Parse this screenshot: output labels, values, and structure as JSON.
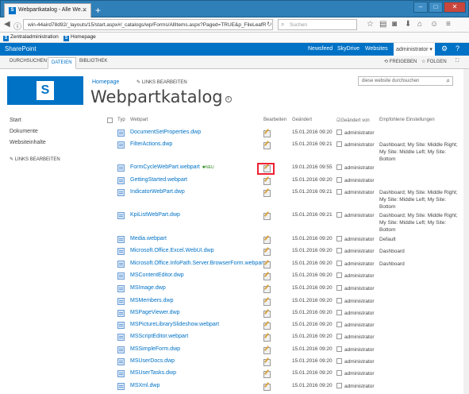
{
  "browser": {
    "tab_title": "Webpartkatalog - Alle We...",
    "new_tab": "+",
    "url": "win-44aird78d92/_layouts/15/start.aspx#/_catalogs/wp/Forms/AllItems.aspx?Paged=TRUE&p_FileLeafR",
    "search_placeholder": "Suchen",
    "bookmarks": [
      "Zentraladministration",
      "Homepage"
    ]
  },
  "suite": {
    "brand": "SharePoint",
    "links": [
      "Newsfeed",
      "SkyDrive",
      "Websites"
    ],
    "user": "administrator"
  },
  "ribbon": {
    "tabs": [
      "DURCHSUCHEN",
      "DATEIEN",
      "BIBLIOTHEK"
    ],
    "active_tab": "DATEIEN",
    "share": "FREIGEBEN",
    "follow": "FOLGEN"
  },
  "header": {
    "breadcrumb": "Homepage",
    "edit_links": "LINKS BEARBEITEN",
    "title": "Webpartkatalog",
    "site_search_placeholder": "diese website durchsuchen"
  },
  "quicklaunch": {
    "items": [
      "Start",
      "Dokumente",
      "Websiteinhalte"
    ],
    "edit_links": "LINKS BEARBEITEN"
  },
  "list": {
    "columns": {
      "type": "Typ",
      "name": "Webpart",
      "edit": "Bearbeiten",
      "modified": "Geändert",
      "modified_by": "Geändert von",
      "recommended": "Empfohlene Einstellungen"
    },
    "new_badge": "NEU",
    "rows": [
      {
        "name": "DocumentSetProperties.dwp",
        "modified": "15.01.2016 09:20",
        "by": "administrator",
        "rec": ""
      },
      {
        "name": "FilterActions.dwp",
        "modified": "15.01.2016 09:21",
        "by": "administrator",
        "rec": "Dashboard; My Site: Middle Right; My Site: Middle Left; My Site: Bottom"
      },
      {
        "name": "FormCycleWebPart.webpart",
        "modified": "19.01.2016 09:55",
        "by": "administrator",
        "rec": ""
      },
      {
        "name": "GettingStarted.webpart",
        "modified": "15.01.2016 09:20",
        "by": "administrator",
        "rec": ""
      },
      {
        "name": "IndicatorWebPart.dwp",
        "modified": "15.01.2016 09:21",
        "by": "administrator",
        "rec": "Dashboard; My Site: Middle Right; My Site: Middle Left; My Site: Bottom"
      },
      {
        "name": "KpiListWebPart.dwp",
        "modified": "15.01.2016 09:21",
        "by": "administrator",
        "rec": "Dashboard; My Site: Middle Right; My Site: Middle Left; My Site: Bottom"
      },
      {
        "name": "Media.webpart",
        "modified": "15.01.2016 09:20",
        "by": "administrator",
        "rec": "Default"
      },
      {
        "name": "Microsoft.Office.Excel.WebUI.dwp",
        "modified": "15.01.2016 09:20",
        "by": "administrator",
        "rec": "Dashboard"
      },
      {
        "name": "Microsoft.Office.InfoPath.Server.BrowserForm.webpart",
        "modified": "15.01.2016 09:20",
        "by": "administrator",
        "rec": "Dashboard"
      },
      {
        "name": "MSContentEditor.dwp",
        "modified": "15.01.2016 09:20",
        "by": "administrator",
        "rec": ""
      },
      {
        "name": "MSImage.dwp",
        "modified": "15.01.2016 09:20",
        "by": "administrator",
        "rec": ""
      },
      {
        "name": "MSMembers.dwp",
        "modified": "15.01.2016 09:20",
        "by": "administrator",
        "rec": ""
      },
      {
        "name": "MSPageViewer.dwp",
        "modified": "15.01.2016 09:20",
        "by": "administrator",
        "rec": ""
      },
      {
        "name": "MSPictureLibrarySlideshow.webpart",
        "modified": "15.01.2016 09:20",
        "by": "administrator",
        "rec": ""
      },
      {
        "name": "MSScriptEditor.webpart",
        "modified": "15.01.2016 09:20",
        "by": "administrator",
        "rec": ""
      },
      {
        "name": "MSSimpleForm.dwp",
        "modified": "15.01.2016 09:20",
        "by": "administrator",
        "rec": ""
      },
      {
        "name": "MSUserDocs.dwp",
        "modified": "15.01.2016 09:20",
        "by": "administrator",
        "rec": ""
      },
      {
        "name": "MSUserTasks.dwp",
        "modified": "15.01.2016 09:20",
        "by": "administrator",
        "rec": ""
      },
      {
        "name": "MSXml.dwp",
        "modified": "15.01.2016 09:20",
        "by": "administrator",
        "rec": ""
      }
    ]
  },
  "colors": {
    "accent": "#0072c6",
    "highlight": "#e22233"
  }
}
